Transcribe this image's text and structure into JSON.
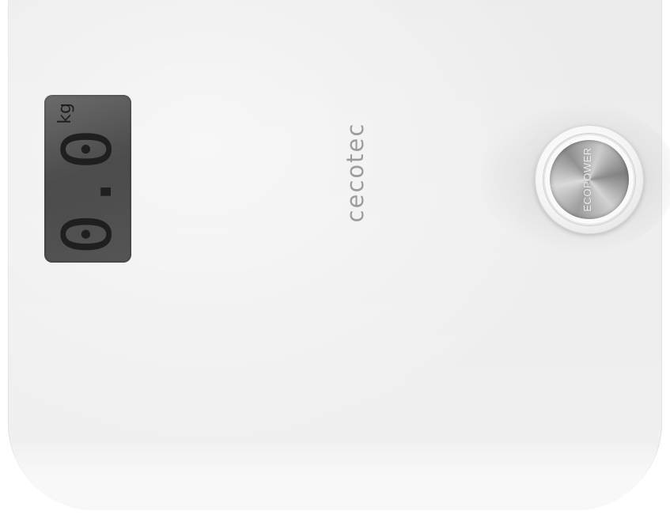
{
  "display": {
    "reading": "0.0",
    "unit": "kg"
  },
  "brand": {
    "logo_text": "cecotec"
  },
  "power_button": {
    "label": "ECOPOWER"
  },
  "colors": {
    "body": "#eeeeee",
    "lcd_background": "#4e4e4e",
    "lcd_digits": "#1f1f1f",
    "logo": "#9c9c9c",
    "button_metal": "#a6a6a6"
  }
}
